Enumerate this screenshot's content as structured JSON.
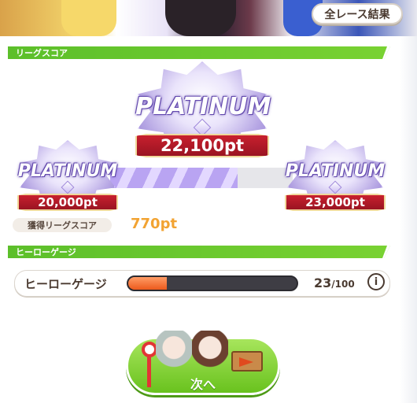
{
  "header": {
    "all_race_results_label": "全レース結果"
  },
  "league_score": {
    "section_title": "リーグスコア",
    "current": {
      "rank": "PLATINUM",
      "points": "22,100pt"
    },
    "previous": {
      "rank": "PLATINUM",
      "points": "20,000pt"
    },
    "next": {
      "rank": "PLATINUM",
      "points": "23,000pt"
    },
    "progress_fraction": 0.7,
    "earned_label": "獲得リーグスコア",
    "earned_value": "770pt"
  },
  "hero_gauge": {
    "section_title": "ヒーローゲージ",
    "label": "ヒーローゲージ",
    "current": "23",
    "max": "/100",
    "fraction": 0.23,
    "info_icon": "i"
  },
  "next_button": {
    "label": "次へ"
  },
  "colors": {
    "section_green": "#6cc82c",
    "ribbon_red": "#b01b28",
    "earned_orange": "#f2a332",
    "gauge_orange": "#ec5a1c"
  }
}
